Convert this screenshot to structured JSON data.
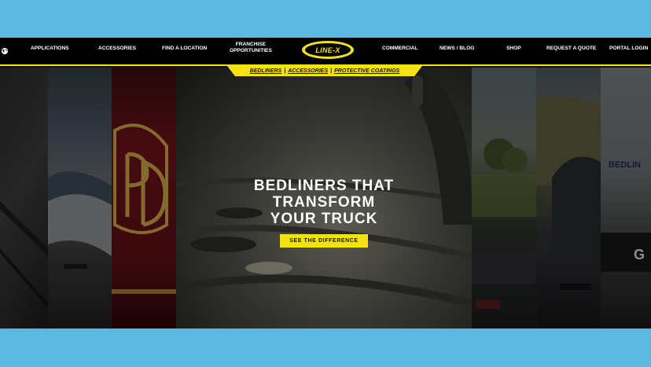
{
  "nav": {
    "left_items": [
      {
        "label": "APPLICATIONS"
      },
      {
        "label": "ACCESSORIES"
      },
      {
        "label": "FIND A LOCATION"
      },
      {
        "label": "FRANCHISE\nOPPORTUNITIES"
      }
    ],
    "logo_text": "LINE-X",
    "right_items": [
      {
        "label": "COMMERCIAL"
      },
      {
        "label": "NEWS / BLOG"
      },
      {
        "label": "SHOP"
      },
      {
        "label": "REQUEST A QUOTE"
      },
      {
        "label": "PORTAL LOGIN"
      }
    ],
    "globe_icon": "globe-icon"
  },
  "subnav": {
    "links": [
      "BEDLINERS",
      "ACCESSORIES",
      "PROTECTIVE COATINGS"
    ],
    "separator": "|"
  },
  "hero": {
    "headline": "BEDLINERS THAT\nTRANSFORM\nYOUR TRUCK",
    "cta_label": "SEE THE DIFFERENCE"
  },
  "colors": {
    "accent": "#f5e11a",
    "nav_bg": "#000000",
    "outer_bg": "#5bb8df"
  }
}
